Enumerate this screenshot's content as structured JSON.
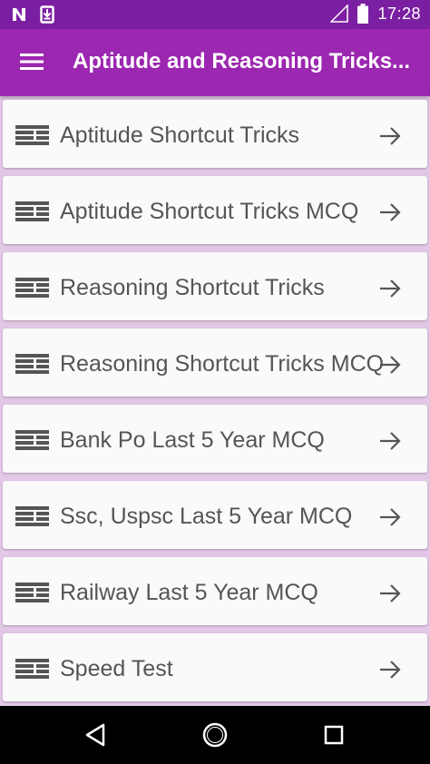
{
  "status_bar": {
    "time": "17:28",
    "icons": [
      "n-notification-icon",
      "download-notification-icon",
      "signal-icon",
      "battery-icon"
    ]
  },
  "app_bar": {
    "title": "Aptitude and Reasoning Tricks...",
    "menu_icon": "hamburger-menu-icon"
  },
  "menu_items": [
    {
      "label": "Aptitude Shortcut Tricks"
    },
    {
      "label": "Aptitude Shortcut Tricks MCQ"
    },
    {
      "label": "Reasoning Shortcut Tricks"
    },
    {
      "label": "Reasoning Shortcut Tricks MCQ"
    },
    {
      "label": "Bank Po Last 5 Year MCQ"
    },
    {
      "label": "Ssc, Uspsc Last 5 Year MCQ"
    },
    {
      "label": "Railway Last 5 Year MCQ"
    },
    {
      "label": "Speed Test"
    }
  ],
  "nav_bar": {
    "icons": [
      "back-icon",
      "home-icon",
      "recents-icon"
    ]
  },
  "colors": {
    "status_bar": "#7b1fa2",
    "app_bar": "#9c27b0",
    "background": "#e2c8e6",
    "card": "#fafafa",
    "text": "#555555"
  }
}
